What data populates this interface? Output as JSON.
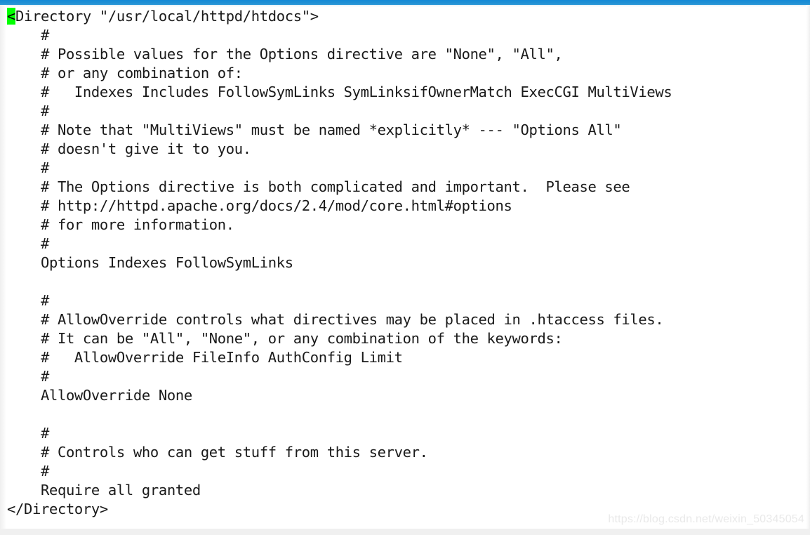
{
  "document": {
    "type": "apache-httpd-config",
    "language": "apache",
    "first_char_highlight": "<",
    "first_char_highlight_color": "#00ff00",
    "lines": [
      {
        "indent": 0,
        "text": "Directory \"/usr/local/httpd/htdocs\">",
        "highlight_first": true,
        "prefix": "<"
      },
      {
        "indent": 4,
        "text": "#"
      },
      {
        "indent": 4,
        "text": "# Possible values for the Options directive are \"None\", \"All\","
      },
      {
        "indent": 4,
        "text": "# or any combination of:"
      },
      {
        "indent": 4,
        "text": "#   Indexes Includes FollowSymLinks SymLinksifOwnerMatch ExecCGI MultiViews"
      },
      {
        "indent": 4,
        "text": "#"
      },
      {
        "indent": 4,
        "text": "# Note that \"MultiViews\" must be named *explicitly* --- \"Options All\""
      },
      {
        "indent": 4,
        "text": "# doesn't give it to you."
      },
      {
        "indent": 4,
        "text": "#"
      },
      {
        "indent": 4,
        "text": "# The Options directive is both complicated and important.  Please see"
      },
      {
        "indent": 4,
        "text": "# http://httpd.apache.org/docs/2.4/mod/core.html#options"
      },
      {
        "indent": 4,
        "text": "# for more information."
      },
      {
        "indent": 4,
        "text": "#"
      },
      {
        "indent": 4,
        "text": "Options Indexes FollowSymLinks"
      },
      {
        "indent": 0,
        "text": ""
      },
      {
        "indent": 4,
        "text": "#"
      },
      {
        "indent": 4,
        "text": "# AllowOverride controls what directives may be placed in .htaccess files."
      },
      {
        "indent": 4,
        "text": "# It can be \"All\", \"None\", or any combination of the keywords:"
      },
      {
        "indent": 4,
        "text": "#   AllowOverride FileInfo AuthConfig Limit"
      },
      {
        "indent": 4,
        "text": "#"
      },
      {
        "indent": 4,
        "text": "AllowOverride None"
      },
      {
        "indent": 0,
        "text": ""
      },
      {
        "indent": 4,
        "text": "#"
      },
      {
        "indent": 4,
        "text": "# Controls who can get stuff from this server."
      },
      {
        "indent": 4,
        "text": "#"
      },
      {
        "indent": 4,
        "text": "Require all granted"
      },
      {
        "indent": 0,
        "text": "</Directory>"
      }
    ]
  },
  "chrome": {
    "top_bar_color": "#1e8fd4",
    "background_color": "#ffffff",
    "text_color": "#1a1a1a"
  },
  "watermark": {
    "text": "https://blog.csdn.net/weixin_50345054",
    "color": "#e9e9e9"
  }
}
